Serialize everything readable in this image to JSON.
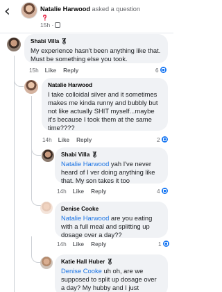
{
  "header": {
    "back_icon": "chevron-left-icon",
    "author": "Natalie Harwood",
    "action": "asked a question",
    "time": "15h",
    "privacy_icon": "globe-icon"
  },
  "comments": [
    {
      "name": "Shabi Villa",
      "text": "My experience hasn't been anything like that.  Must be something else you took.",
      "time": "15h",
      "like": "Like",
      "reply": "Reply",
      "reactions": "6"
    },
    {
      "name": "Natalie Harwood",
      "text": "I take colloidal silver and it sometimes makes me kinda runny and bubbly but not like actually SHIT myself...maybe it's because I took them at the same time????",
      "time": "14h",
      "like": "Like",
      "reply": "Reply",
      "reactions": "2"
    },
    {
      "name": "Shabi Villa",
      "mention": "Natalie Harwood",
      "text": " yah I've never heard of I ver doing anything like that.  My son takes it too",
      "time": "14h",
      "like": "Like",
      "reply": "Reply",
      "reactions": "4"
    },
    {
      "name": "Denise Cooke",
      "mention": "Natalie Harwood",
      "text": " are you eating with a full meal and splitting up dosage over a day??",
      "time": "14h",
      "like": "Like",
      "reply": "Reply",
      "reactions": "1"
    },
    {
      "name": "Katie Hall Huber",
      "mention": "Denise Cooke",
      "text": " uh oh, are we supposed to split up dosage over a day? My hubby and I just",
      "time": "",
      "like": "",
      "reply": "",
      "reactions": ""
    }
  ],
  "colors": {
    "accent": "#1b74e4",
    "bubble": "#f0f2f5",
    "meta": "#65676b"
  }
}
